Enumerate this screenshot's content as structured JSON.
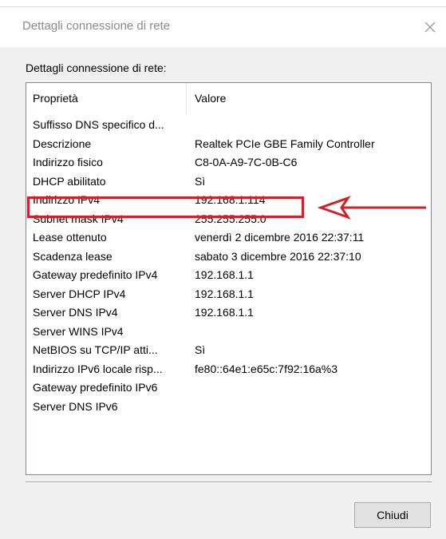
{
  "window": {
    "title": "Dettagli connessione di rete"
  },
  "group_label": "Dettagli connessione di rete:",
  "columns": [
    "Proprietà",
    "Valore"
  ],
  "rows": [
    {
      "property": "Suffisso DNS specifico d...",
      "value": ""
    },
    {
      "property": "Descrizione",
      "value": "Realtek PCIe GBE Family Controller"
    },
    {
      "property": "Indirizzo fisico",
      "value": "C8-0A-A9-7C-0B-C6"
    },
    {
      "property": "DHCP abilitato",
      "value": "Sì"
    },
    {
      "property": "Indirizzo IPv4",
      "value": "192.168.1.114"
    },
    {
      "property": "Subnet mask IPv4",
      "value": "255.255.255.0"
    },
    {
      "property": "Lease ottenuto",
      "value": "venerdì 2 dicembre 2016 22:37:11"
    },
    {
      "property": "Scadenza lease",
      "value": "sabato 3 dicembre 2016 22:37:10"
    },
    {
      "property": "Gateway predefinito IPv4",
      "value": "192.168.1.1"
    },
    {
      "property": "Server DHCP IPv4",
      "value": "192.168.1.1"
    },
    {
      "property": "Server DNS IPv4",
      "value": "192.168.1.1"
    },
    {
      "property": "Server WINS IPv4",
      "value": ""
    },
    {
      "property": "NetBIOS su TCP/IP atti...",
      "value": "Sì"
    },
    {
      "property": "Indirizzo IPv6 locale risp...",
      "value": "fe80::64e1:e65c:7f92:16a%3"
    },
    {
      "property": "Gateway predefinito IPv6",
      "value": ""
    },
    {
      "property": "Server DNS IPv6",
      "value": ""
    }
  ],
  "annotation": {
    "color": "#d51f26",
    "icon": "left-arrow-icon"
  },
  "buttons": {
    "close_label": "Chiudi"
  },
  "icons": {
    "close": "close-x-icon"
  }
}
